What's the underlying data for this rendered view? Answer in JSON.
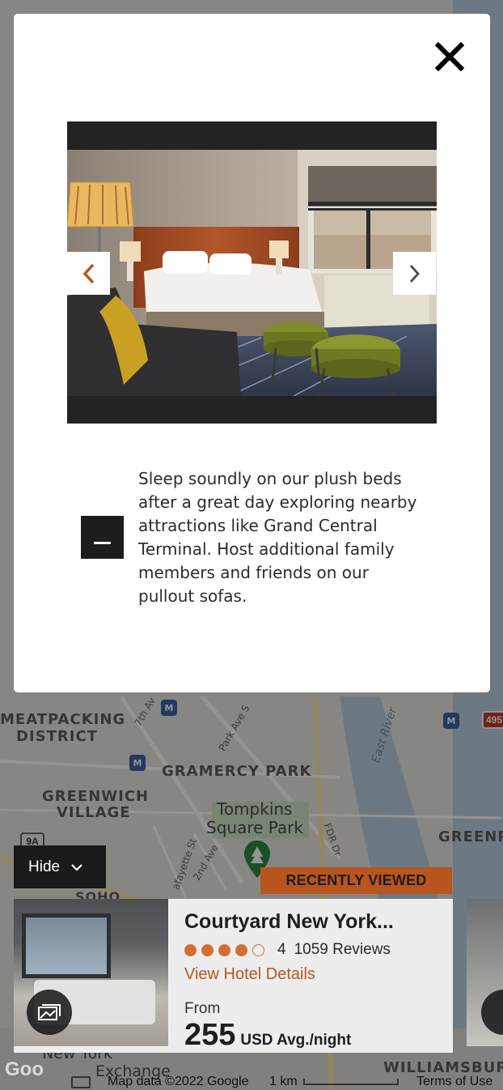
{
  "map": {
    "labels": {
      "meatpacking": "MEATPACKING",
      "district": "DISTRICT",
      "gramercy": "GRAMERCY PARK",
      "greenwich": "GREENWICH",
      "village": "VILLAGE",
      "tompkins": "Tompkins",
      "square_park": "Square Park",
      "greenpoint": "GREENP",
      "soho": "SOHO",
      "williamsburg": "WILLIAMSBUR",
      "east_river": "East River",
      "park_ave": "Park Ave S",
      "seventh_av": "7th Av",
      "lafayette": "afayette St",
      "second_ave": "2nd Ave",
      "fdr": "FDR Dr",
      "new_york": "New York",
      "exchange": "Exchange"
    },
    "route_shield": "9A",
    "highway_shield": "495",
    "footer": {
      "map_data": "Map data ©2022 Google",
      "scale": "1 km",
      "terms": "Terms of Use"
    },
    "google_logo": "Goo"
  },
  "hide_button": {
    "label": "Hide",
    "icon": "chevron-down-icon"
  },
  "recently_viewed_label": "RECENTLY VIEWED",
  "hotel_card": {
    "name": "Courtyard New York...",
    "rating": 4,
    "rating_max": 5,
    "rating_display": "4",
    "reviews": "1059 Reviews",
    "view_details": "View Hotel Details",
    "from_label": "From",
    "price": "255",
    "price_unit": "USD Avg./night",
    "gallery_icon": "gallery-icon"
  },
  "modal": {
    "close_icon": "close-icon",
    "prev_icon": "chevron-left-icon",
    "next_icon": "chevron-right-icon",
    "collapse_icon": "minus-icon",
    "caption": "Sleep soundly on our plush beds after a great day exploring nearby attractions like Grand Central Terminal. Host additional family members and friends on our pullout sofas.",
    "accent_color": "#b8551f"
  }
}
